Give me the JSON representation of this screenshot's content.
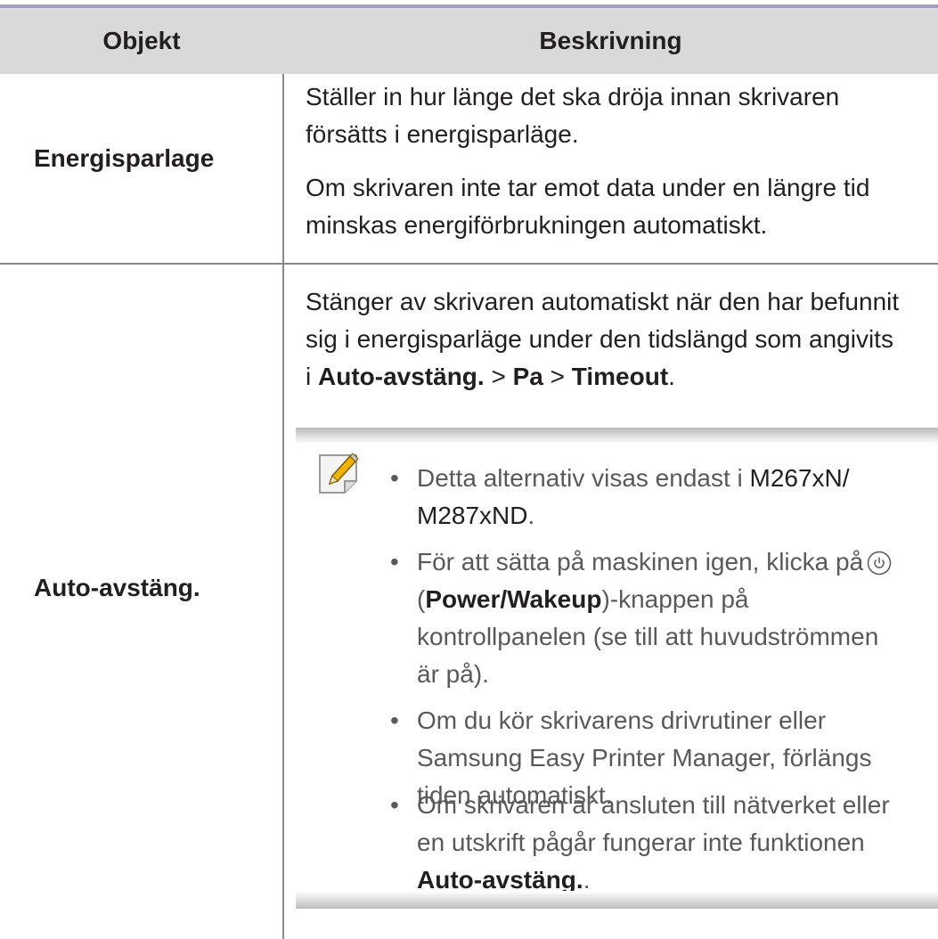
{
  "table": {
    "headers": [
      "Objekt",
      "Beskrivning"
    ],
    "rows": [
      {
        "item": "Energisparlage",
        "paragraphs": [
          [
            "Ställer in hur länge det ska dröja innan skrivaren",
            "försätts i energisparläge."
          ],
          [
            "Om skrivaren inte tar emot data under en längre tid",
            "minskas energiförbrukningen automatiskt."
          ]
        ]
      },
      {
        "item": "Auto-avstäng.",
        "description": {
          "line1": "Stänger av skrivaren automatiskt när den har befunnit",
          "line2": "sig i energisparläge under den tidslängd som angivits",
          "line3_prefix": "i ",
          "path1": "Auto-avstäng.",
          "sep1": " > ",
          "path2": "Pa",
          "sep2": " > ",
          "path3": "Timeout",
          "line3_suffix": "."
        },
        "note": {
          "icon": "note-pencil-icon",
          "bullets": {
            "b1_l1_pre": "Detta alternativ visas endast i ",
            "b1_l1_model": "M267xN/",
            "b1_l2_model": "M287xND",
            "b1_l2_post": ".",
            "b2_l1": "För att sätta på maskinen igen, klicka på",
            "b2_l2_open": "(",
            "b2_l2_bold": "Power/Wakeup",
            "b2_l2_rest": ")-knappen på",
            "b2_l3": "kontrollpanelen (se till att huvudströmmen",
            "b2_l4": "är på).",
            "b3_l1": "Om du kör skrivarens drivrutiner eller",
            "b3_l2": "Samsung Easy Printer Manager, förlängs",
            "b3_l3": "tiden automatiskt.",
            "b4_l1": "Om skrivaren är ansluten till nätverket eller",
            "b4_l2": "en utskrift pågår fungerar inte funktionen",
            "b4_l3_bold": "Auto-avstäng.",
            "b4_l3_post": "."
          },
          "bullet_char": "•"
        }
      }
    ]
  },
  "colors": {
    "header_bg": "#d9d9d9",
    "top_rule": "#a39fc3",
    "note_text": "#58595b"
  }
}
